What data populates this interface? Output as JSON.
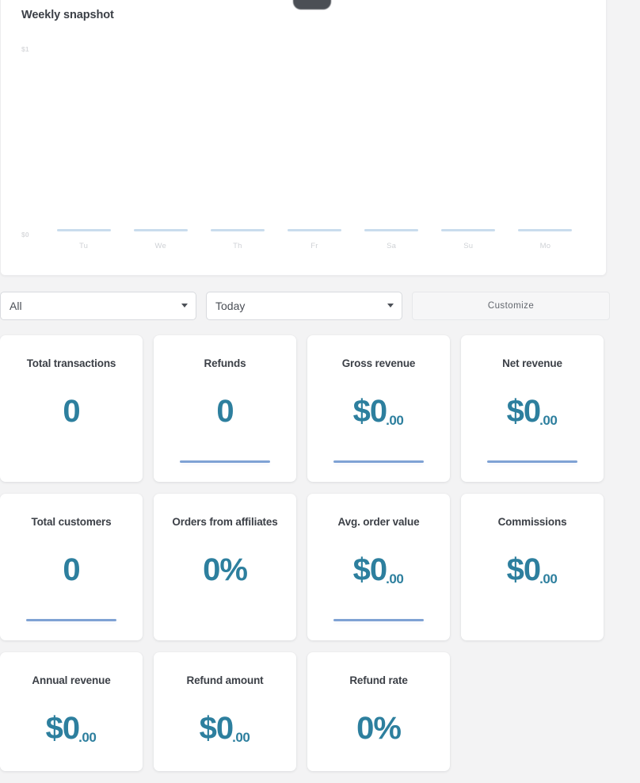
{
  "chart": {
    "title": "Weekly snapshot",
    "y_top_label": "$1",
    "y_zero_label": "$0"
  },
  "chart_data": {
    "type": "bar",
    "title": "Weekly snapshot",
    "categories": [
      "Tu",
      "We",
      "Th",
      "Fr",
      "Sa",
      "Su",
      "Mo"
    ],
    "values": [
      0,
      0,
      0,
      0,
      0,
      0,
      0
    ],
    "xlabel": "",
    "ylabel": "",
    "ylim": [
      0,
      1
    ],
    "ytick_labels": [
      "$0",
      "$1"
    ],
    "grid": false,
    "legend": false,
    "bar_color": "#c9dced"
  },
  "filters": {
    "scope_select": {
      "value": "All",
      "options": [
        "All"
      ]
    },
    "period_select": {
      "value": "Today",
      "options": [
        "Today"
      ]
    },
    "customize_label": "Customize"
  },
  "cards": [
    [
      {
        "label": "Total transactions",
        "value": "0",
        "cents": "",
        "underline": false
      },
      {
        "label": "Refunds",
        "value": "0",
        "cents": "",
        "underline": true
      },
      {
        "label": "Gross revenue",
        "value": "$0",
        "cents": ".00",
        "underline": true
      },
      {
        "label": "Net revenue",
        "value": "$0",
        "cents": ".00",
        "underline": true
      }
    ],
    [
      {
        "label": "Total customers",
        "value": "0",
        "cents": "",
        "underline": true
      },
      {
        "label": "Orders from affiliates",
        "value": "0%",
        "cents": "",
        "underline": false
      },
      {
        "label": "Avg. order value",
        "value": "$0",
        "cents": ".00",
        "underline": true
      },
      {
        "label": "Commissions",
        "value": "$0",
        "cents": ".00",
        "underline": false
      }
    ],
    [
      {
        "label": "Annual revenue",
        "value": "$0",
        "cents": ".00",
        "underline": false
      },
      {
        "label": "Refund amount",
        "value": "$0",
        "cents": ".00",
        "underline": false
      },
      {
        "label": "Refund rate",
        "value": "0%",
        "cents": "",
        "underline": false
      }
    ]
  ],
  "colors": {
    "value_accent": "#2d7f9e",
    "underline": "#7fa2d4",
    "bar": "#c9dced",
    "page_bg": "#f3f3f4"
  }
}
